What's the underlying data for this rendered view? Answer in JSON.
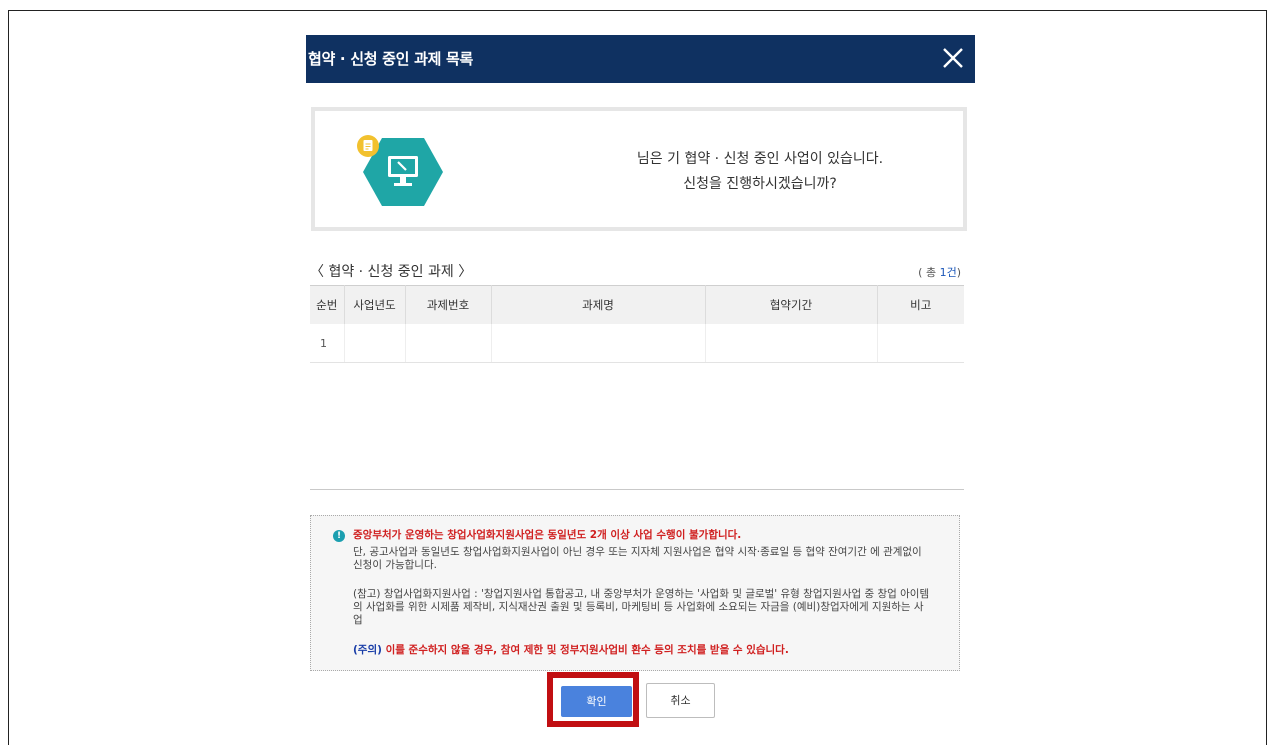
{
  "modal": {
    "title": "협약 · 신청 중인 과제 목록",
    "info_line1": "님은 기 협약 · 신청 중인 사업이 있습니다.",
    "info_line2": "신청을 진행하시겠습니까?",
    "section_title": "〈 협약 · 신청 중인 과제 〉",
    "count_prefix": "( 총 ",
    "count_value": "1건",
    "count_suffix": ")"
  },
  "table": {
    "headers": [
      "순번",
      "사업년도",
      "과제번호",
      "과제명",
      "협약기간",
      "비고"
    ],
    "rows": [
      [
        "1",
        "",
        "",
        "",
        "",
        ""
      ]
    ]
  },
  "notice": {
    "line1": "중앙부처가 운영하는 창업사업화지원사업은 동일년도 2개 이상 사업 수행이 불가합니다.",
    "p2": "단, 공고사업과 동일년도 창업사업화지원사업이 아닌 경우 또는 지자체 지원사업은 협약 시작·종료일 등 협약 잔여기간 에 관계없이 신청이 가능합니다.",
    "p3": "(참고) 창업사업화지원사업 : '창업지원사업 통합공고, 내 중앙부처가 운영하는 '사업화 및 글로벌' 유형 창업지원사업 중 창업 아이템의 사업화를 위한 시제품 제작비, 지식재산권 출원 및 등록비, 마케팅비 등 사업화에 소요되는 자금을 (예비)창업자에게 지원하는 사업",
    "caution_label": "(주의)",
    "caution_text": " 이를 준수하지 않을 경우, 참여 제한 및 정부지원사업비 환수 등의 조치를 받을 수 있습니다."
  },
  "buttons": {
    "ok": "확인",
    "cancel": "취소"
  },
  "colors": {
    "header_bg": "#0f3161",
    "ok_bg": "#4a82dd",
    "highlight": "#c10f12",
    "icon_teal": "#1fa6a6",
    "icon_yellow": "#f2c12e"
  }
}
